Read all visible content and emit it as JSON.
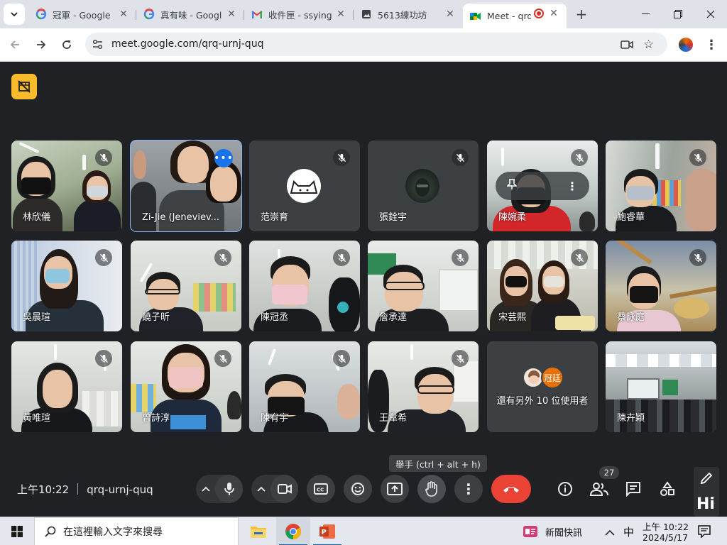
{
  "browser": {
    "tabs": [
      {
        "title": "冠軍 - Google",
        "icon": "google-g-icon"
      },
      {
        "title": "真有味 - Googl",
        "icon": "google-g-icon"
      },
      {
        "title": "收件匣 - ssying",
        "icon": "gmail-icon"
      },
      {
        "title": "5613練功坊",
        "icon": "document-icon"
      },
      {
        "title": "Meet - qrq",
        "icon": "meet-icon",
        "active": true,
        "recording": true
      }
    ],
    "url": "meet.google.com/qrq-urnj-quq"
  },
  "meet": {
    "participants": [
      {
        "name": "林欣儀"
      },
      {
        "name": "Zi-Jie (Jeneviev..."
      },
      {
        "name": "范崇育"
      },
      {
        "name": "張銓宇"
      },
      {
        "name": "陳婉柔"
      },
      {
        "name": "鮑睿華"
      },
      {
        "name": "吳晨瑄"
      },
      {
        "name": "饒子昕"
      },
      {
        "name": "陳冠丞"
      },
      {
        "name": "詹承達"
      },
      {
        "name": "宋芸熙"
      },
      {
        "name": "蔡詠庭"
      },
      {
        "name": "黃唯瑄"
      },
      {
        "name": "曾詩淳"
      },
      {
        "name": "陳宥宇"
      },
      {
        "name": "王韋希"
      },
      {
        "name": "還有另外 10 位使用者",
        "avatar_label": "冠廷"
      },
      {
        "name": "陳卉穎"
      }
    ],
    "time": "上午10:22",
    "meeting_code": "qrq-urnj-quq",
    "tooltip": "舉手 (ctrl + alt + h)",
    "people_count": "27",
    "widget_label": "Hi"
  },
  "taskbar": {
    "search_placeholder": "在這裡輸入文字來搜尋",
    "news": "新聞快訊",
    "ime": "中",
    "clock_time": "上午 10:22",
    "clock_date": "2024/5/17"
  }
}
